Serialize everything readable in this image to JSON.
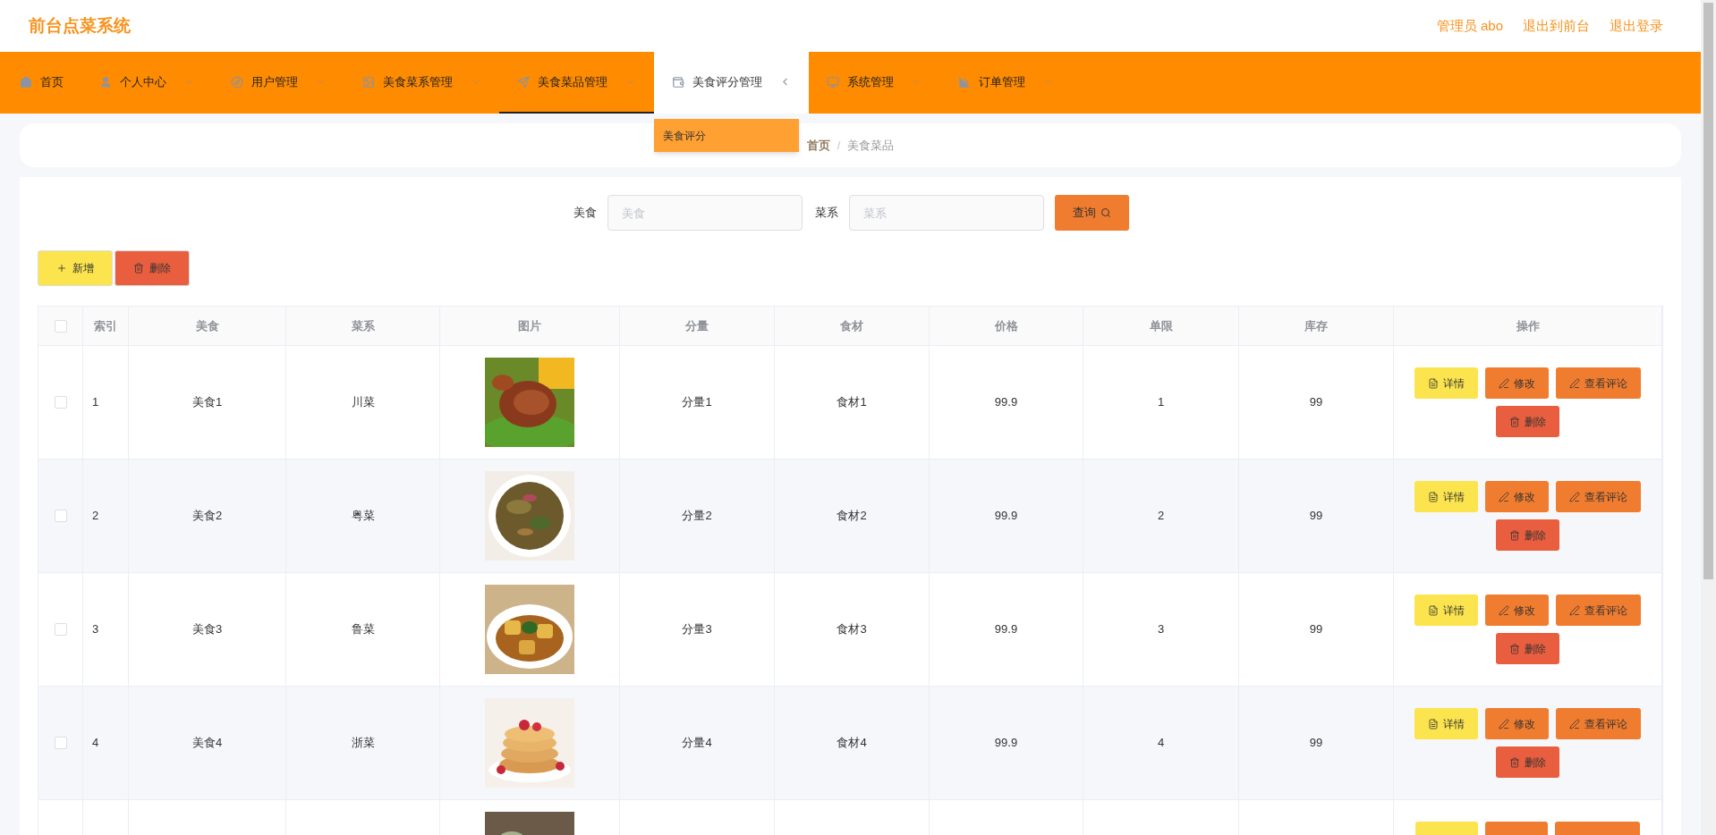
{
  "header": {
    "title": "前台点菜系统",
    "links": [
      "管理员 abo",
      "退出到前台",
      "退出登录"
    ]
  },
  "nav": [
    {
      "label": "首页",
      "selected": false,
      "submenu": false,
      "expanded": false
    },
    {
      "label": "个人中心",
      "selected": false,
      "submenu": true,
      "expanded": false
    },
    {
      "label": "用户管理",
      "selected": false,
      "submenu": true,
      "expanded": false
    },
    {
      "label": "美食菜系管理",
      "selected": false,
      "submenu": true,
      "expanded": false
    },
    {
      "label": "美食菜品管理",
      "selected": true,
      "submenu": true,
      "expanded": false
    },
    {
      "label": "美食评分管理",
      "selected": false,
      "submenu": true,
      "expanded": true,
      "children": [
        {
          "label": "美食评分"
        }
      ]
    },
    {
      "label": "系统管理",
      "selected": false,
      "submenu": true,
      "expanded": false
    },
    {
      "label": "订单管理",
      "selected": false,
      "submenu": true,
      "expanded": false
    }
  ],
  "breadcrumb": {
    "items": [
      "首页",
      "美食菜品"
    ],
    "separator": "/"
  },
  "search": {
    "fields": [
      {
        "label": "美食",
        "placeholder": "美食"
      },
      {
        "label": "菜系",
        "placeholder": "菜系"
      }
    ],
    "button": "查询"
  },
  "toolbar": [
    {
      "label": "新增",
      "kind": "add"
    },
    {
      "label": "删除",
      "kind": "delete"
    }
  ],
  "table": {
    "header_checked": false,
    "columns": [
      "索引",
      "美食",
      "菜系",
      "图片",
      "分量",
      "食材",
      "价格",
      "单限",
      "库存",
      "操作"
    ],
    "rows": [
      {
        "checked": false,
        "cells": [
          "1",
          "美食1",
          "川菜",
          "分量1",
          "食材1",
          "99.9",
          "1",
          "99"
        ],
        "image": {
          "kind": "picture"
        },
        "actions": [
          {
            "label": "详情",
            "kind": "detail"
          },
          {
            "label": "修改",
            "kind": "edit"
          },
          {
            "label": "查看评论",
            "kind": "comments"
          },
          {
            "label": "删除",
            "kind": "delete"
          }
        ]
      },
      {
        "checked": false,
        "cells": [
          "2",
          "美食2",
          "粤菜",
          "分量2",
          "食材2",
          "99.9",
          "2",
          "99"
        ],
        "image": {
          "kind": "picture"
        },
        "actions": [
          {
            "label": "详情",
            "kind": "detail"
          },
          {
            "label": "修改",
            "kind": "edit"
          },
          {
            "label": "查看评论",
            "kind": "comments"
          },
          {
            "label": "删除",
            "kind": "delete"
          }
        ]
      },
      {
        "checked": false,
        "cells": [
          "3",
          "美食3",
          "鲁菜",
          "分量3",
          "食材3",
          "99.9",
          "3",
          "99"
        ],
        "image": {
          "kind": "picture"
        },
        "actions": [
          {
            "label": "详情",
            "kind": "detail"
          },
          {
            "label": "修改",
            "kind": "edit"
          },
          {
            "label": "查看评论",
            "kind": "comments"
          },
          {
            "label": "删除",
            "kind": "delete"
          }
        ]
      },
      {
        "checked": false,
        "cells": [
          "4",
          "美食4",
          "浙菜",
          "分量4",
          "食材4",
          "99.9",
          "4",
          "99"
        ],
        "image": {
          "kind": "picture"
        },
        "actions": [
          {
            "label": "详情",
            "kind": "detail"
          },
          {
            "label": "修改",
            "kind": "edit"
          },
          {
            "label": "查看评论",
            "kind": "comments"
          },
          {
            "label": "删除",
            "kind": "delete"
          }
        ]
      },
      {
        "image": {
          "kind": "picture"
        },
        "actions": [
          {
            "kind": "detail"
          },
          {
            "kind": "edit"
          },
          {
            "kind": "comments"
          }
        ]
      }
    ]
  }
}
